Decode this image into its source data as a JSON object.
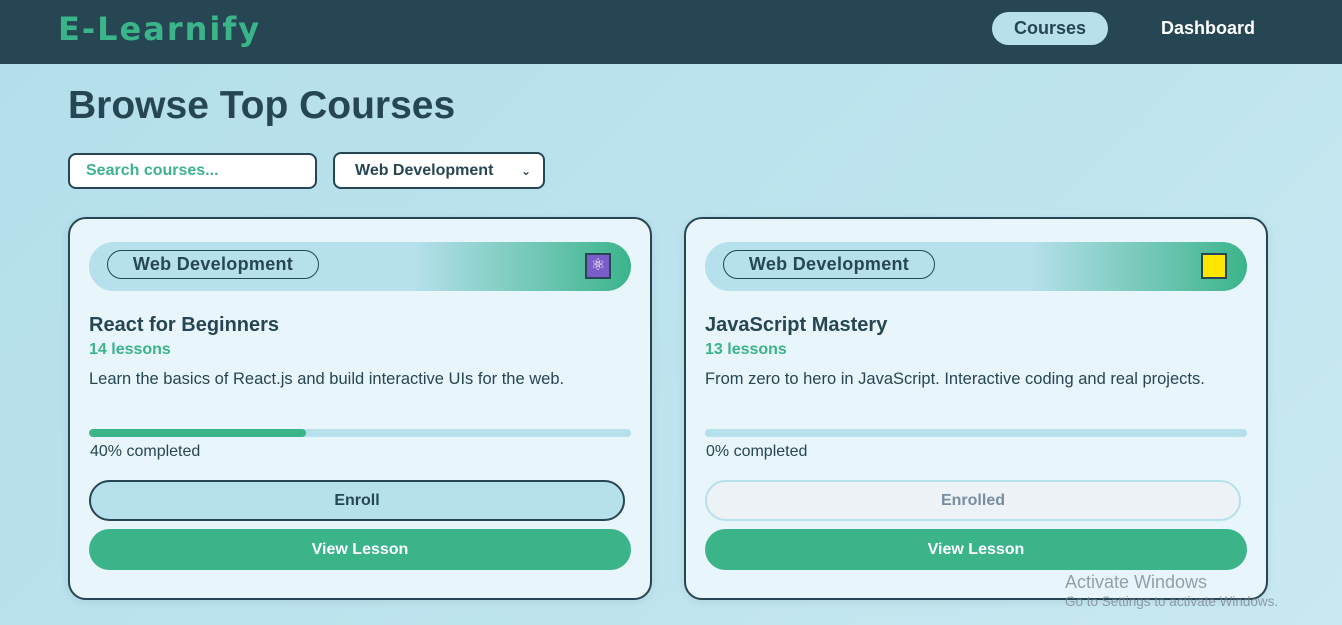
{
  "app": {
    "brand": "E-Learnify"
  },
  "nav": {
    "courses": "Courses",
    "dashboard": "Dashboard"
  },
  "page": {
    "title": "Browse Top Courses"
  },
  "filters": {
    "search_placeholder": "Search courses...",
    "category_selected": "Web Development"
  },
  "colors": {
    "primary": "#264653",
    "accent": "#3bb48a",
    "light": "#b6e0ec",
    "card_bg": "#e8f5fa"
  },
  "courses": [
    {
      "category": "Web Development",
      "icon": "atom-icon",
      "title": "React for Beginners",
      "lessons": "14 lessons",
      "description": "Learn the basics of React.js and build interactive UIs for the web.",
      "progress": 0.4,
      "progress_text": "40% completed",
      "enroll_label": "Enroll",
      "view_label": "View Lesson"
    },
    {
      "category": "Web Development",
      "icon": "javascript-icon",
      "title": "JavaScript Mastery",
      "lessons": "13 lessons",
      "description": "From zero to hero in JavaScript. Interactive coding and real projects.",
      "progress": 0,
      "progress_text": "0% completed",
      "enroll_label": "Enrolled",
      "view_label": "View Lesson"
    }
  ],
  "watermark": {
    "title": "Activate Windows",
    "subtitle": "Go to Settings to activate Windows."
  }
}
